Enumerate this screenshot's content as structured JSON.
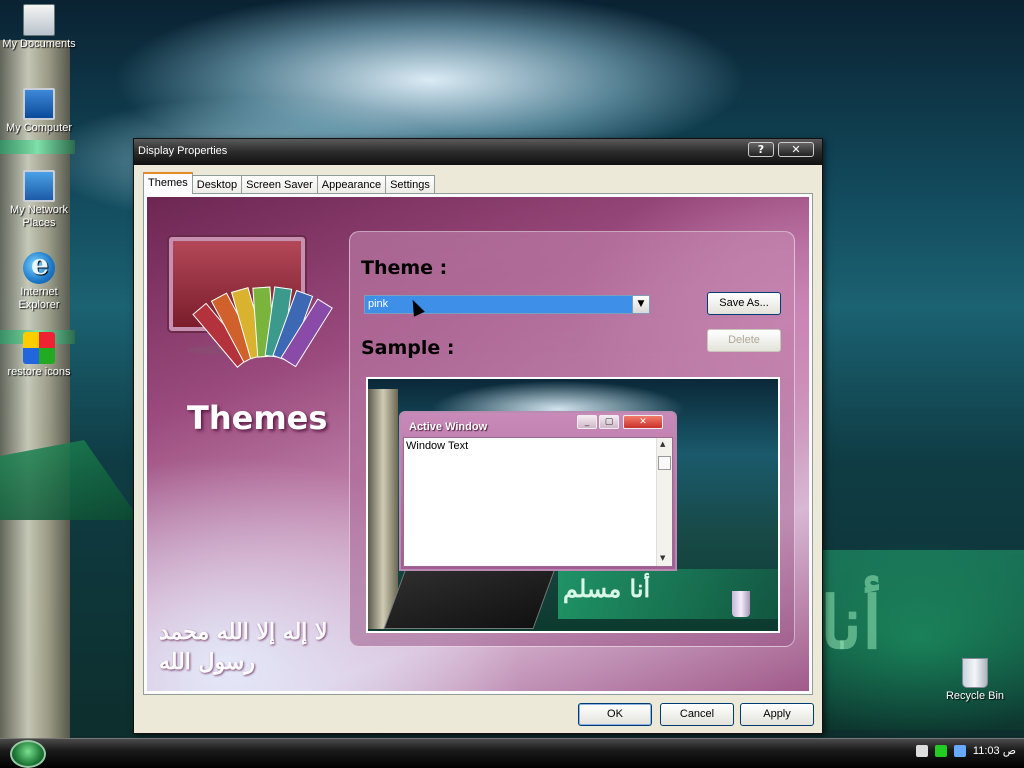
{
  "desktop": {
    "icons": [
      {
        "label": "My Documents",
        "icon": "my-documents-icon"
      },
      {
        "label": "My Computer",
        "icon": "my-computer-icon"
      },
      {
        "label": "My Network Places",
        "icon": "network-places-icon"
      },
      {
        "label": "Internet Explorer",
        "icon": "internet-explorer-icon"
      },
      {
        "label": "restore icons",
        "icon": "restore-icons-icon"
      },
      {
        "label": "Recycle Bin",
        "icon": "recycle-bin-icon"
      }
    ]
  },
  "dialog": {
    "title": "Display Properties",
    "help_glyph": "?",
    "close_glyph": "✕",
    "tabs": [
      {
        "label": "Themes",
        "active": true
      },
      {
        "label": "Desktop",
        "active": false
      },
      {
        "label": "Screen Saver",
        "active": false
      },
      {
        "label": "Appearance",
        "active": false
      },
      {
        "label": "Settings",
        "active": false
      }
    ],
    "themes_heading": "Themes",
    "theme_label": "Theme :",
    "theme_select": {
      "value": "pink",
      "arrow": "▼"
    },
    "save_as_label": "Save As...",
    "delete_label": "Delete",
    "sample_label": "Sample :",
    "sample": {
      "active_window_title": "Active Window",
      "window_text": "Window Text",
      "arabic_text": "أنا مسلم"
    },
    "calligraphy": "لا إله إلا الله محمد رسول الله",
    "ok_label": "OK",
    "cancel_label": "Cancel",
    "apply_label": "Apply"
  },
  "taskbar": {
    "clock": "11:03",
    "ampm": "ص"
  },
  "colors": {
    "accent_tab": "#e68b2c",
    "theme_pink": "#a45c94",
    "selection_blue": "#3d8fe8"
  }
}
